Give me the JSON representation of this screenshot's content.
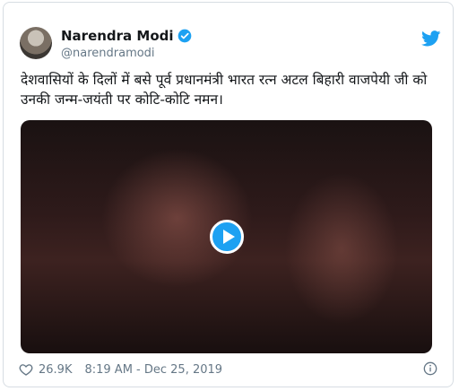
{
  "author": {
    "name": "Narendra Modi",
    "handle": "@narendramodi"
  },
  "tweet": {
    "text": "देशवासियों के दिलों में बसे पूर्व प्रधानमंत्री भारत रत्न अटल बिहारी वाजपेयी जी को उनकी जन्म-जयंती पर कोटि-कोटि नमन।"
  },
  "footer": {
    "likes": "26.9K",
    "timestamp": "8:19 AM - Dec 25, 2019"
  },
  "icons": {
    "verified": "verified-badge-icon",
    "twitter": "twitter-bird-icon",
    "play": "play-icon",
    "heart": "heart-icon",
    "info": "info-icon"
  },
  "colors": {
    "accent": "#1da1f2",
    "secondary_text": "#657786"
  }
}
